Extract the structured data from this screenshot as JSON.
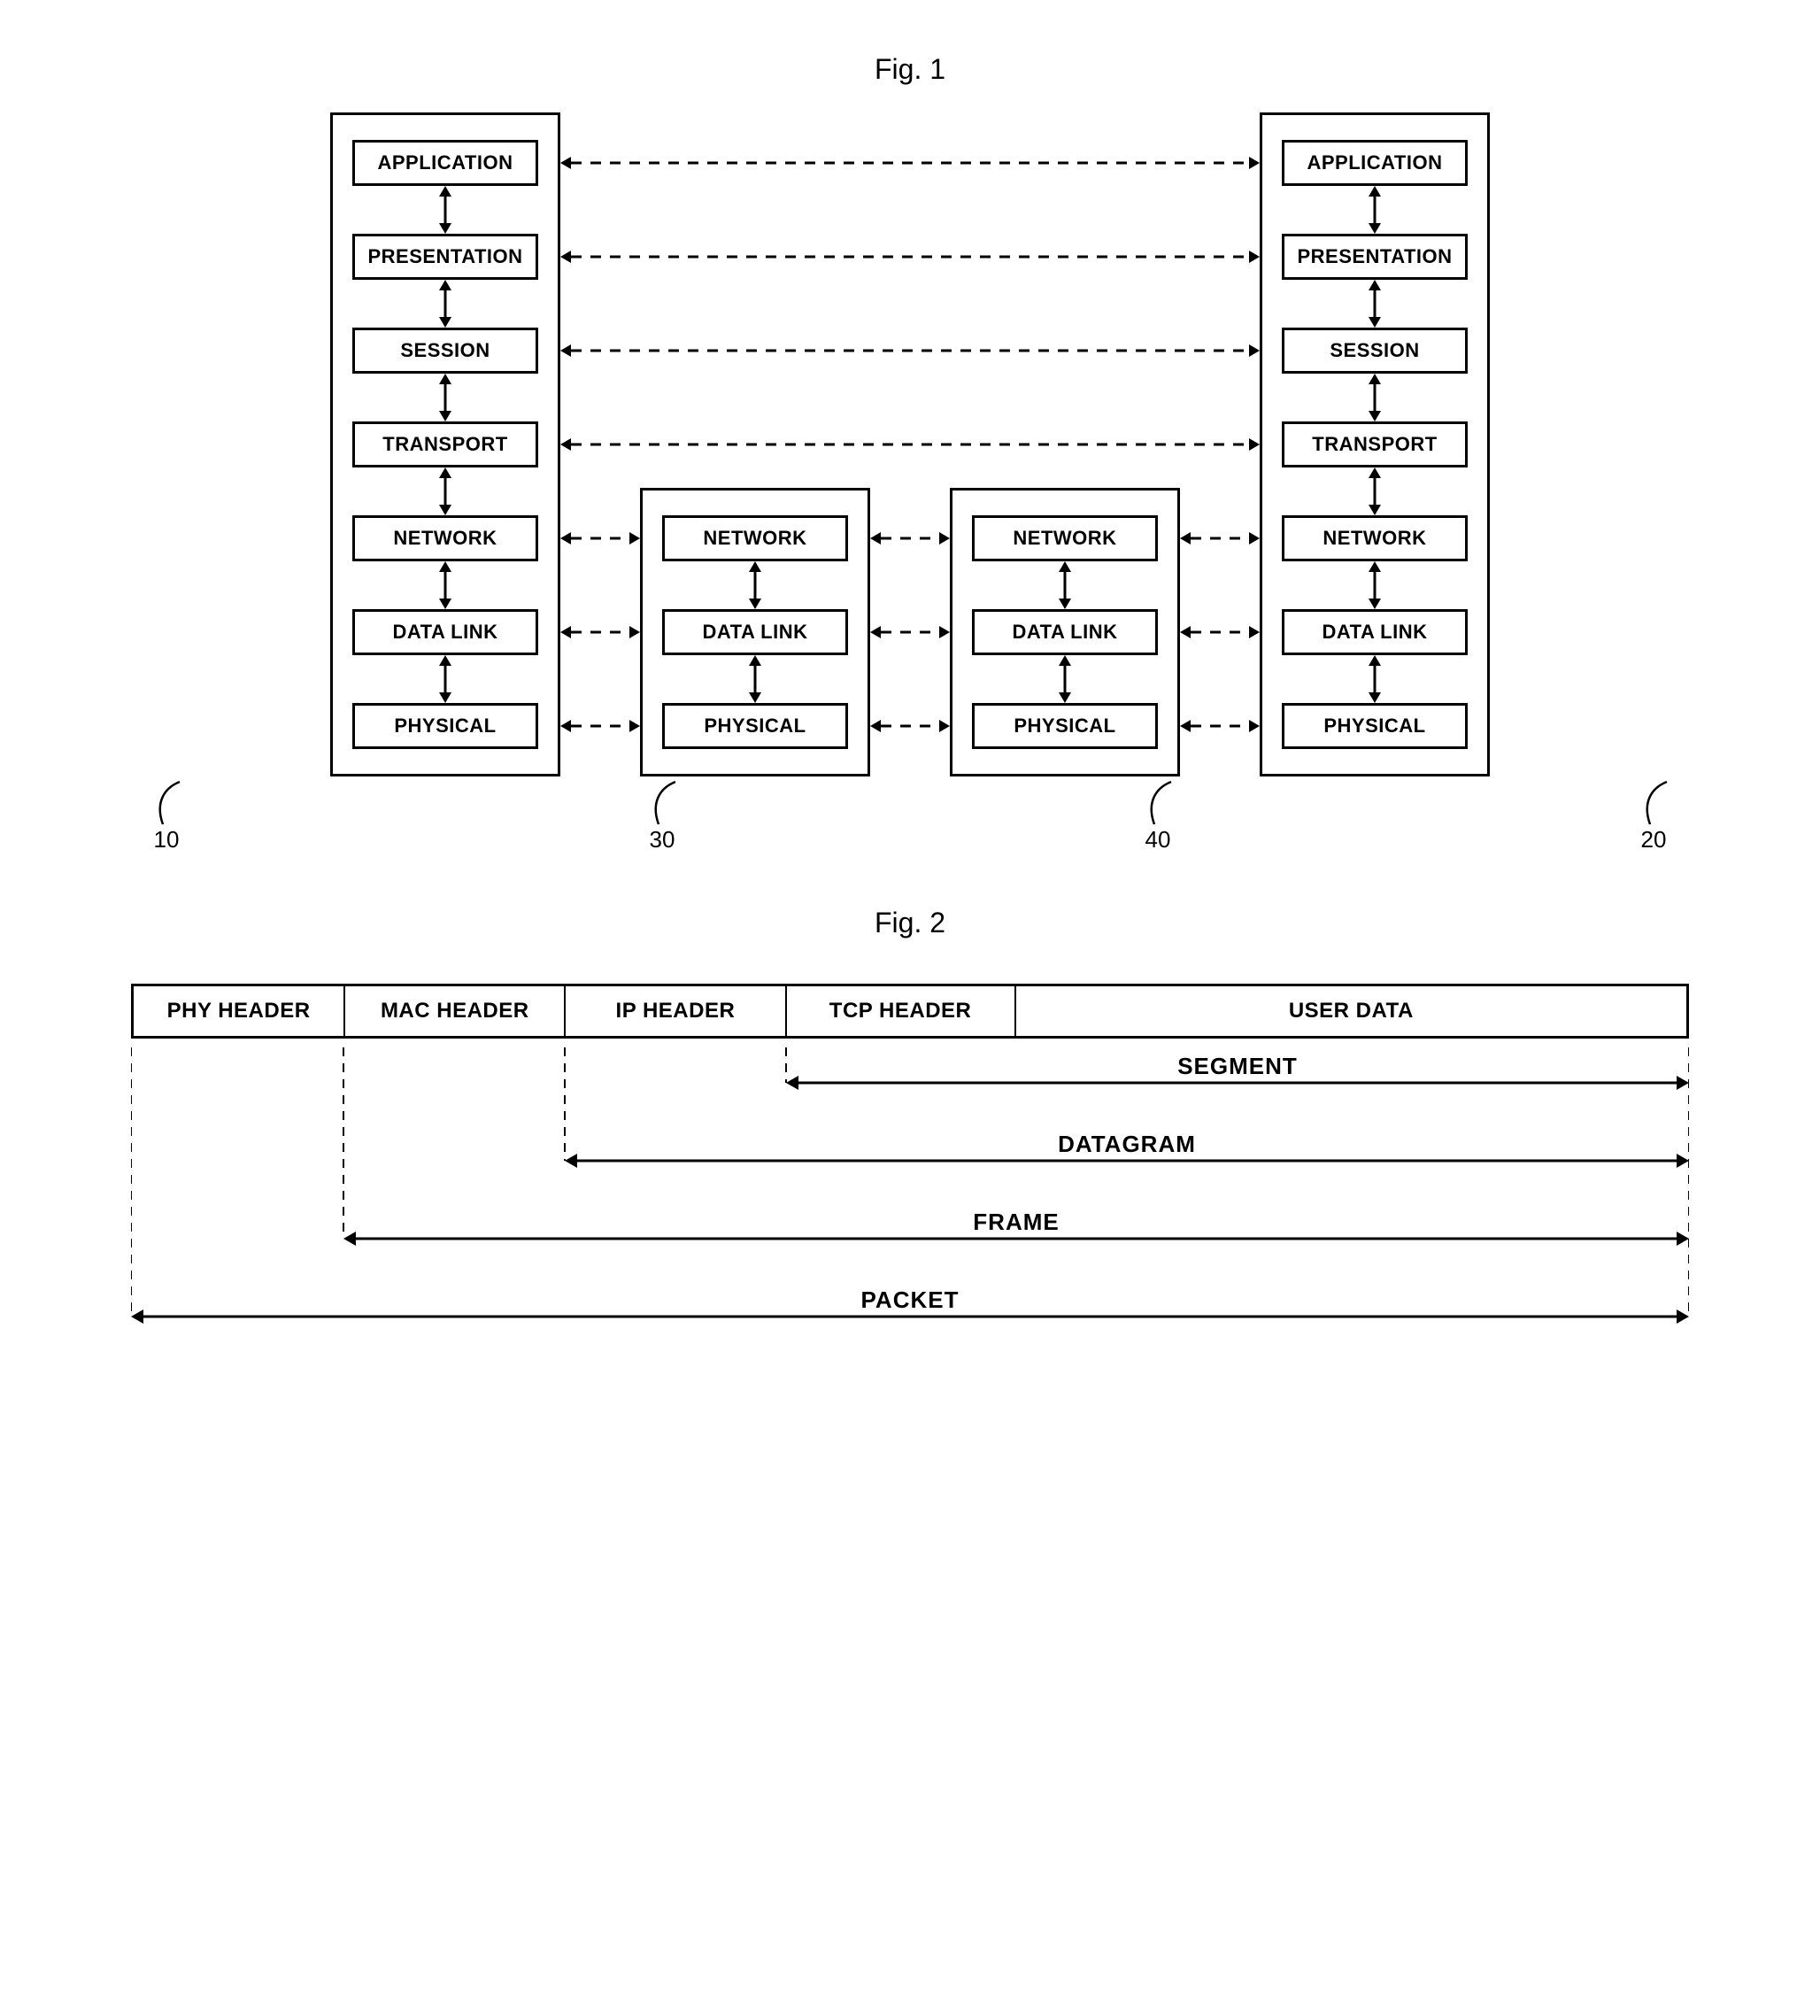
{
  "fig1": {
    "title": "Fig. 1",
    "stacks": {
      "left": [
        "APPLICATION",
        "PRESENTATION",
        "SESSION",
        "TRANSPORT",
        "NETWORK",
        "DATA LINK",
        "PHYSICAL"
      ],
      "mid1": [
        "NETWORK",
        "DATA LINK",
        "PHYSICAL"
      ],
      "mid2": [
        "NETWORK",
        "DATA LINK",
        "PHYSICAL"
      ],
      "right": [
        "APPLICATION",
        "PRESENTATION",
        "SESSION",
        "TRANSPORT",
        "NETWORK",
        "DATA LINK",
        "PHYSICAL"
      ]
    },
    "refs": {
      "left": "10",
      "mid1": "30",
      "mid2": "40",
      "right": "20"
    }
  },
  "fig2": {
    "title": "Fig. 2",
    "cells": [
      "PHY HEADER",
      "MAC HEADER",
      "IP HEADER",
      "TCP HEADER",
      "USER DATA"
    ],
    "extents": [
      {
        "label": "SEGMENT",
        "fromCell": 3
      },
      {
        "label": "DATAGRAM",
        "fromCell": 2
      },
      {
        "label": "FRAME",
        "fromCell": 1
      },
      {
        "label": "PACKET",
        "fromCell": 0
      }
    ],
    "cellWidths": [
      240,
      250,
      250,
      260,
      760
    ]
  }
}
